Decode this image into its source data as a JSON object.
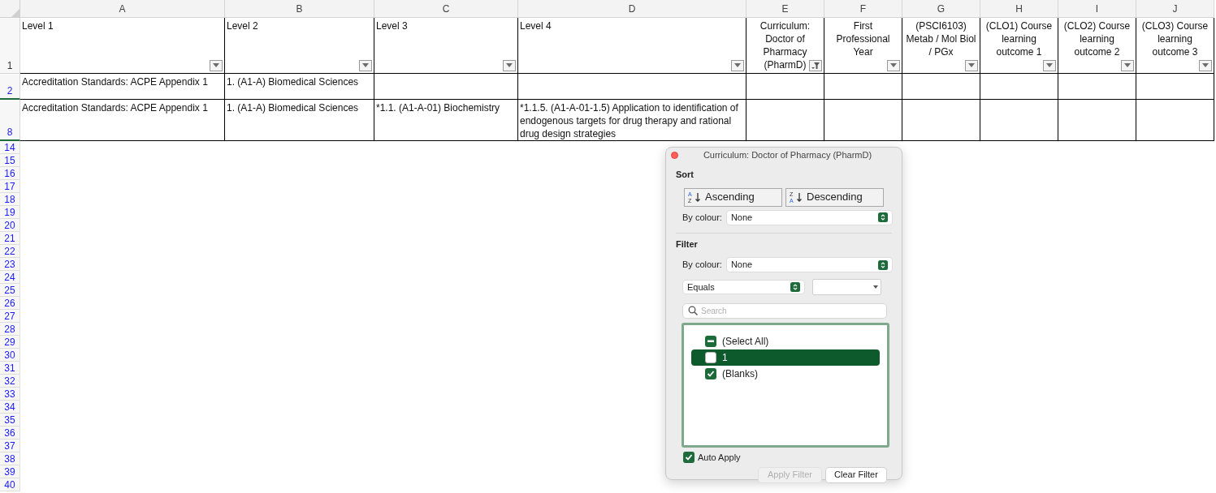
{
  "columns": [
    "A",
    "B",
    "C",
    "D",
    "E",
    "F",
    "G",
    "H",
    "I",
    "J"
  ],
  "header_row": {
    "number": "1",
    "filtered": false,
    "cells": [
      {
        "text": "Level 1",
        "filter_active": false
      },
      {
        "text": "Level 2",
        "filter_active": false
      },
      {
        "text": "Level 3",
        "filter_active": false
      },
      {
        "text": "Level 4",
        "filter_active": false
      },
      {
        "text": "Curriculum: Doctor of Pharmacy (PharmD)",
        "filter_active": true
      },
      {
        "text": "First Professional Year",
        "filter_active": false
      },
      {
        "text": "(PSCI6103) Metab / Mol Biol / PGx",
        "filter_active": false
      },
      {
        "text": "(CLO1) Course learning outcome 1",
        "filter_active": false
      },
      {
        "text": "(CLO2) Course learning outcome 2",
        "filter_active": false
      },
      {
        "text": "(CLO3) Course learning outcome 3",
        "filter_active": false
      }
    ]
  },
  "rows": [
    {
      "number": "2",
      "filtered": true,
      "cells": [
        "Accreditation Standards: ACPE Appendix 1",
        "1. (A1-A) Biomedical Sciences"
      ]
    },
    {
      "number": "8",
      "filtered": true,
      "cells": [
        "Accreditation Standards: ACPE Appendix 1",
        "1. (A1-A) Biomedical Sciences",
        "*1.1. (A1-A-01) Biochemistry",
        "*1.1.5. (A1-A-01-1.5) Application to identification of endogenous targets for drug therapy and rational drug design strategies"
      ]
    }
  ],
  "empty_rows": [
    {
      "number": "14",
      "filtered": true
    },
    {
      "number": "15",
      "filtered": true
    },
    {
      "number": "16",
      "filtered": true
    },
    {
      "number": "17",
      "filtered": true
    },
    {
      "number": "18",
      "filtered": true
    },
    {
      "number": "19",
      "filtered": true
    },
    {
      "number": "20",
      "filtered": true
    },
    {
      "number": "21",
      "filtered": true
    },
    {
      "number": "22",
      "filtered": true
    },
    {
      "number": "23",
      "filtered": true
    },
    {
      "number": "24",
      "filtered": true
    },
    {
      "number": "25",
      "filtered": true
    },
    {
      "number": "26",
      "filtered": true
    },
    {
      "number": "27",
      "filtered": true
    },
    {
      "number": "28",
      "filtered": true
    },
    {
      "number": "29",
      "filtered": true
    },
    {
      "number": "30",
      "filtered": true
    },
    {
      "number": "31",
      "filtered": true
    },
    {
      "number": "32",
      "filtered": true
    },
    {
      "number": "33",
      "filtered": true
    },
    {
      "number": "34",
      "filtered": true
    },
    {
      "number": "35",
      "filtered": true
    },
    {
      "number": "36",
      "filtered": true
    },
    {
      "number": "37",
      "filtered": true
    },
    {
      "number": "38",
      "filtered": true
    },
    {
      "number": "39",
      "filtered": true
    },
    {
      "number": "40",
      "filtered": true
    }
  ],
  "filter_popup": {
    "title": "Curriculum: Doctor of Pharmacy (PharmD)",
    "sort": {
      "heading": "Sort",
      "ascending": "Ascending",
      "ascending_icon_letters": [
        "A",
        "Z"
      ],
      "descending": "Descending",
      "descending_icon_letters": [
        "Z",
        "A"
      ],
      "by_colour_label": "By colour:",
      "by_colour_value": "None"
    },
    "filter": {
      "heading": "Filter",
      "by_colour_label": "By colour:",
      "by_colour_value": "None",
      "condition": "Equals",
      "search_placeholder": "Search",
      "items": [
        {
          "label": "(Select All)",
          "indeterminate": true,
          "selected": false
        },
        {
          "label": "1",
          "checked": false,
          "indeterminate": false,
          "selected": true
        },
        {
          "label": "(Blanks)",
          "checked": true,
          "selected": false
        }
      ]
    },
    "auto_apply": {
      "label": "Auto Apply",
      "checked": true
    },
    "apply_button": {
      "label": "Apply Filter",
      "disabled": true
    },
    "clear_button": {
      "label": "Clear Filter",
      "disabled": false
    }
  }
}
